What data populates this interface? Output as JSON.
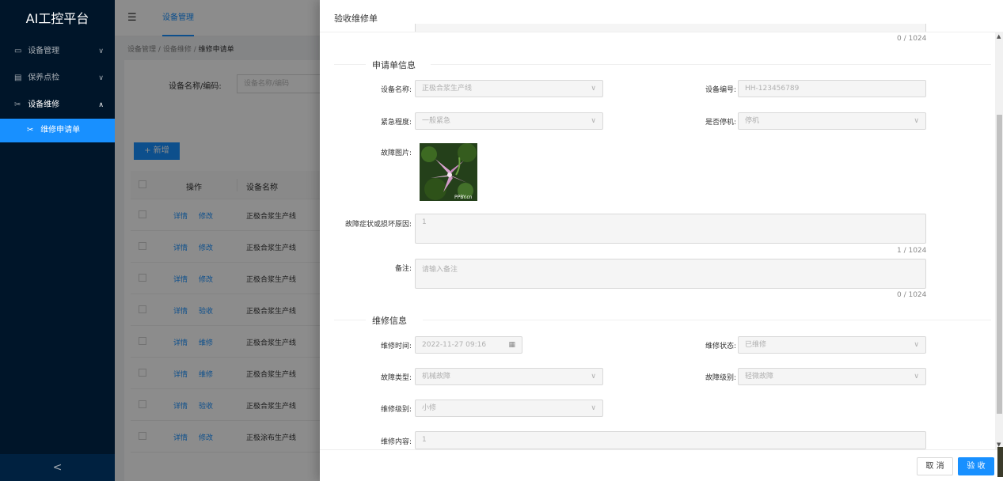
{
  "app": {
    "logo": "AI工控平台"
  },
  "sidebar": {
    "items": [
      {
        "label": "设备管理",
        "icon": "monitor-icon",
        "glyph": "▭",
        "caret": "∨"
      },
      {
        "label": "保养点检",
        "icon": "clipboard-icon",
        "glyph": "▤",
        "caret": "∨"
      },
      {
        "label": "设备维修",
        "icon": "wrench-icon",
        "glyph": "✂",
        "caret": "∧"
      }
    ],
    "subitem": {
      "label": "维修申请单",
      "glyph": "✂"
    },
    "collapse_glyph": "<"
  },
  "header": {
    "hamburger_glyph": "☰",
    "tab": "设备管理"
  },
  "breadcrumb": {
    "part1": "设备管理",
    "sep": "/",
    "part2": "设备维修",
    "current": "维修申请单"
  },
  "search": {
    "label": "设备名称/编码:",
    "placeholder": "设备名称/编码"
  },
  "table": {
    "add_label": "+ 新增",
    "col_op": "操作",
    "col_name": "设备名称",
    "rows": [
      {
        "a1": "详情",
        "a2": "修改",
        "name": "正极合浆生产线"
      },
      {
        "a1": "详情",
        "a2": "修改",
        "name": "正极合浆生产线"
      },
      {
        "a1": "详情",
        "a2": "修改",
        "name": "正极合浆生产线"
      },
      {
        "a1": "详情",
        "a2": "验收",
        "name": "正极合浆生产线"
      },
      {
        "a1": "详情",
        "a2": "维修",
        "name": "正极合浆生产线"
      },
      {
        "a1": "详情",
        "a2": "维修",
        "name": "正极合浆生产线"
      },
      {
        "a1": "详情",
        "a2": "验收",
        "name": "正极合浆生产线"
      },
      {
        "a1": "详情",
        "a2": "修改",
        "name": "正极涂布生产线"
      }
    ]
  },
  "drawer": {
    "title": "验收维修单",
    "top_counter": "0 / 1024",
    "section1": "申请单信息",
    "device_name_label": "设备名称:",
    "device_name_value": "正极合浆生产线",
    "device_code_label": "设备编号:",
    "device_code_value": "HH-123456789",
    "urgency_label": "紧急程度:",
    "urgency_value": "一般紧急",
    "shutdown_label": "是否停机:",
    "shutdown_value": "停机",
    "fault_image_label": "故障图片:",
    "fault_image_watermark": "PPBY.cn",
    "symptom_label": "故障症状或损坏原因:",
    "symptom_value": "1",
    "symptom_counter": "1 / 1024",
    "remark_label": "备注:",
    "remark_placeholder": "请输入备注",
    "remark_counter": "0 / 1024",
    "section2": "维修信息",
    "repair_time_label": "维修时间:",
    "repair_time_value": "2022-11-27 09:16",
    "repair_status_label": "维修状态:",
    "repair_status_value": "已维修",
    "fault_type_label": "故障类型:",
    "fault_type_value": "机械故障",
    "fault_level_label": "故障级别:",
    "fault_level_value": "轻微故障",
    "repair_level_label": "维修级别:",
    "repair_level_value": "小修",
    "repair_content_label": "维修内容:",
    "repair_content_value": "1",
    "chevron_glyph": "∨",
    "calendar_glyph": "▦",
    "scroll_up_glyph": "▲",
    "scroll_down_glyph": "▼",
    "cancel_label": "取 消",
    "accept_label": "验 收"
  },
  "colors": {
    "primary": "#1890ff",
    "sidebar_bg": "#001529",
    "disabled_bg": "#f5f5f5"
  }
}
